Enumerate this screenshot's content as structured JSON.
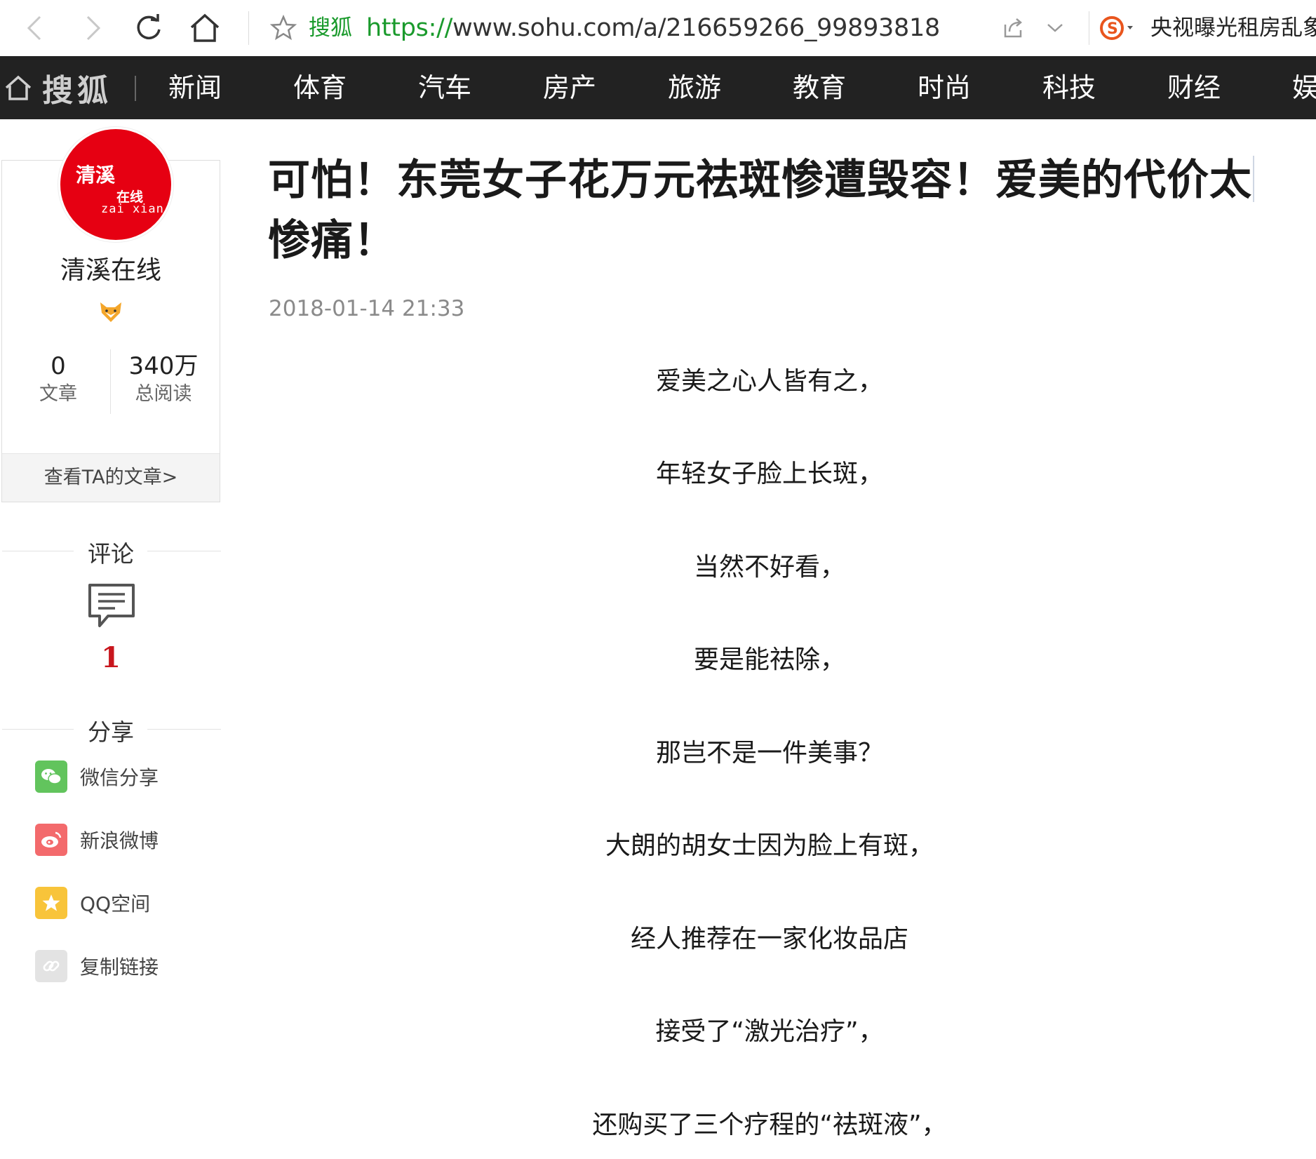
{
  "browser": {
    "site_label": "搜狐",
    "url_scheme": "https://",
    "url_rest": "www.sohu.com/a/216659266_99893818",
    "news_ticker": "央视曝光租房乱象"
  },
  "nav": {
    "logo": "搜狐",
    "items": [
      "新闻",
      "体育",
      "汽车",
      "房产",
      "旅游",
      "教育",
      "时尚",
      "科技",
      "财经",
      "娱"
    ]
  },
  "author": {
    "avatar_text_1": "清溪",
    "avatar_text_2": "在线",
    "avatar_text_3": "zai xian",
    "name": "清溪在线",
    "articles_count": "0",
    "articles_label": "文章",
    "reads_count": "340万",
    "reads_label": "总阅读",
    "view_more": "查看TA的文章>"
  },
  "comments": {
    "heading": "评论",
    "count": "1"
  },
  "share": {
    "heading": "分享",
    "items": [
      {
        "label": "微信分享",
        "color": "#62c45d"
      },
      {
        "label": "新浪微博",
        "color": "#f36a6c"
      },
      {
        "label": "QQ空间",
        "color": "#f8c43a"
      },
      {
        "label": "复制链接",
        "color": "#e3e3e3"
      }
    ]
  },
  "article": {
    "title": "可怕！东莞女子花万元祛斑惨遭毁容！爱美的代价太惨痛！",
    "time": "2018-01-14 21:33",
    "paragraphs": [
      "爱美之心人皆有之，",
      "年轻女子脸上长斑，",
      "当然不好看，",
      "要是能祛除，",
      "那岂不是一件美事？",
      "大朗的胡女士因为脸上有斑，",
      "经人推荐在一家化妆品店",
      "接受了“激光治疗”，",
      "还购买了三个疗程的“祛斑液”，"
    ]
  }
}
